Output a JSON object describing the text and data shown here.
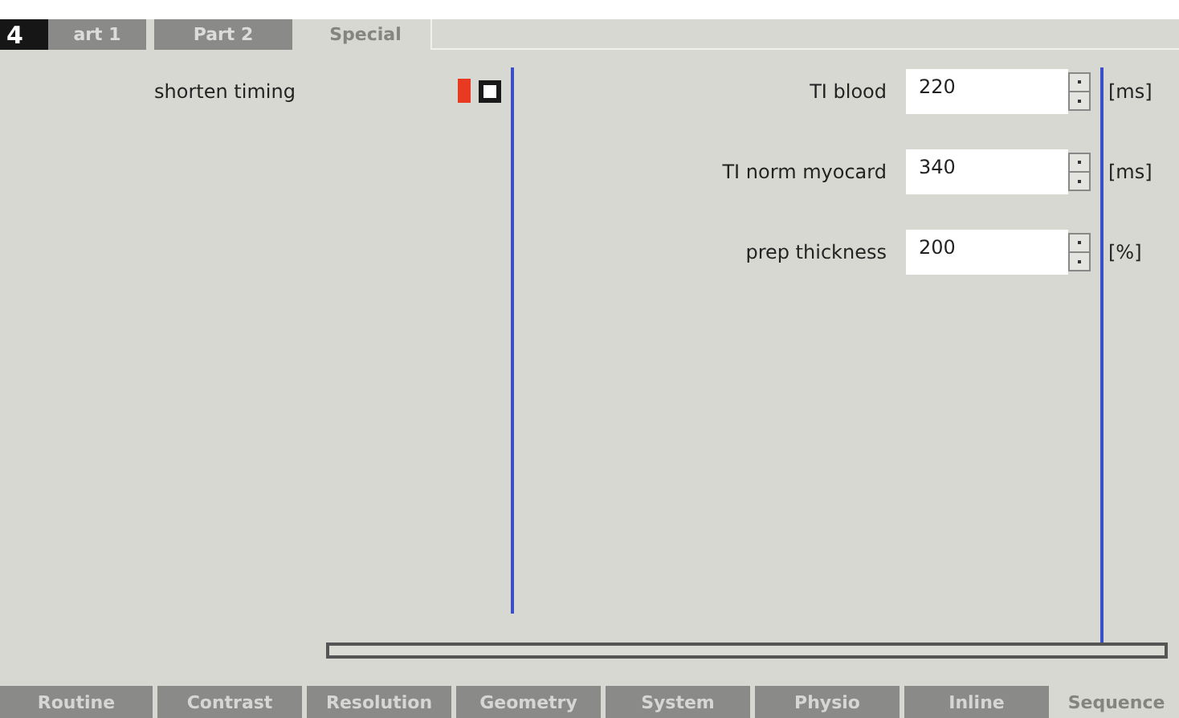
{
  "figure_label": "4",
  "top_tabs": [
    {
      "label": "art 1",
      "selected": false
    },
    {
      "label": "Part 2",
      "selected": false
    },
    {
      "label": "Special",
      "selected": true
    }
  ],
  "shorten_timing": {
    "label": "shorten timing",
    "checked": false
  },
  "parameters": [
    {
      "label": "TI blood",
      "value": "220",
      "unit": "[ms]"
    },
    {
      "label": "TI norm myocard",
      "value": "340",
      "unit": "[ms]"
    },
    {
      "label": "prep thickness",
      "value": "200",
      "unit": "[%]"
    }
  ],
  "bottom_tabs": [
    {
      "label": "Routine",
      "selected": false
    },
    {
      "label": "Contrast",
      "selected": false
    },
    {
      "label": "Resolution",
      "selected": false
    },
    {
      "label": "Geometry",
      "selected": false
    },
    {
      "label": "System",
      "selected": false
    },
    {
      "label": "Physio",
      "selected": false
    },
    {
      "label": "Inline",
      "selected": false
    },
    {
      "label": "Sequence",
      "selected": true
    }
  ]
}
